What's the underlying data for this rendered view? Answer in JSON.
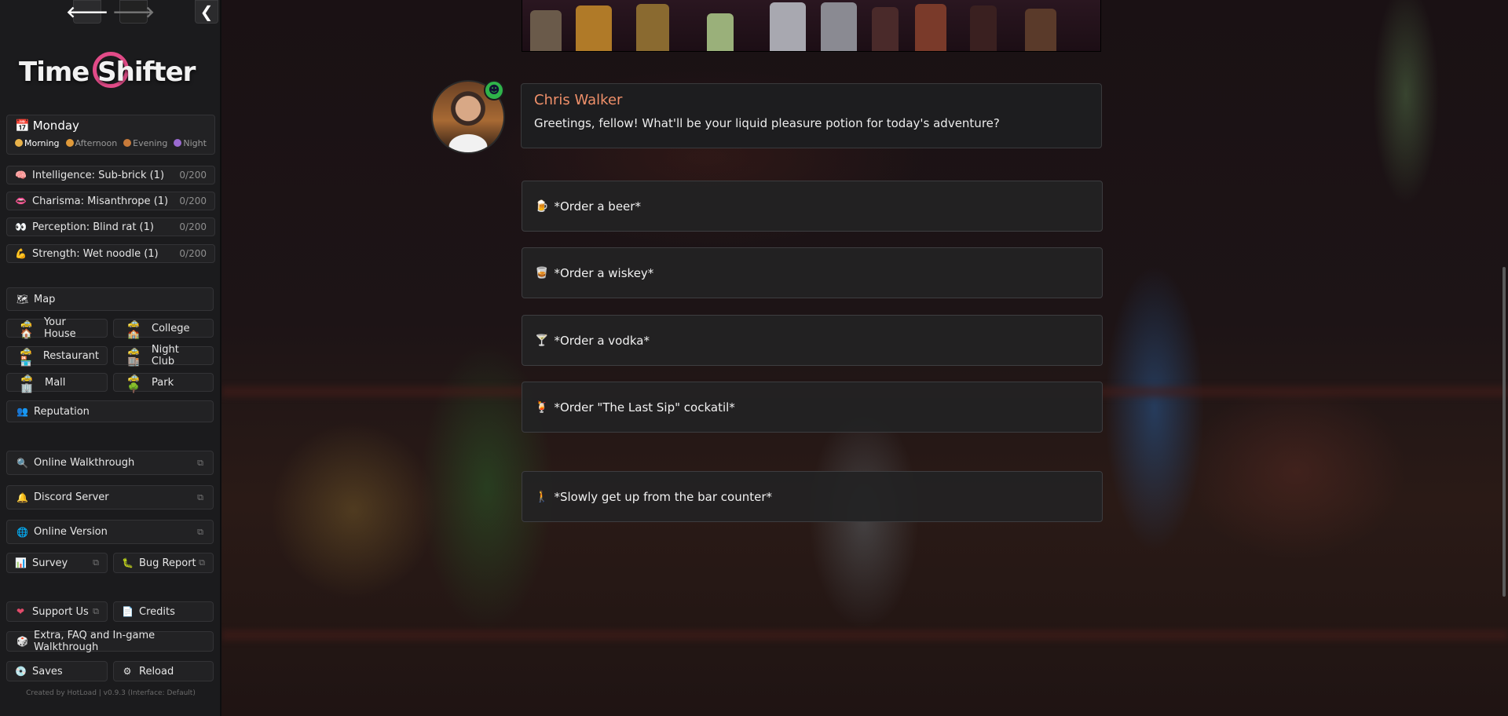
{
  "app": {
    "logo": "Time Shifter"
  },
  "nav": {
    "back": "🡐",
    "forward": "🡒",
    "collapse": "❮"
  },
  "day": {
    "name": "Monday",
    "times": [
      {
        "label": "Morning",
        "color": "#e8b24a",
        "active": true
      },
      {
        "label": "Afternoon",
        "color": "#e09a3a",
        "active": false
      },
      {
        "label": "Evening",
        "color": "#c77a3a",
        "active": false
      },
      {
        "label": "Night",
        "color": "#9a6ad0",
        "active": false
      }
    ]
  },
  "stats": [
    {
      "icon": "🧠",
      "label": "Intelligence: Sub-brick (1)",
      "value": "0/200"
    },
    {
      "icon": "👄",
      "label": "Charisma: Misanthrope (1)",
      "value": "0/200"
    },
    {
      "icon": "👀",
      "label": "Perception: Blind rat (1)",
      "value": "0/200"
    },
    {
      "icon": "💪",
      "label": "Strength: Wet noodle (1)",
      "value": "0/200"
    }
  ],
  "map": {
    "title": "Map",
    "icon": "🗺",
    "locations": [
      {
        "icon": "🚕 🏠",
        "label": "Your House"
      },
      {
        "icon": "🚕 🏫",
        "label": "College"
      },
      {
        "icon": "🚕 🏪",
        "label": "Restaurant"
      },
      {
        "icon": "🚕 🏬",
        "label": "Night Club"
      },
      {
        "icon": "🚕 🏢",
        "label": "Mall"
      },
      {
        "icon": "🚕 🌳",
        "label": "Park"
      }
    ]
  },
  "reputation": {
    "icon": "👥",
    "label": "Reputation"
  },
  "links": [
    {
      "icon": "🔍",
      "label": "Online Walkthrough"
    },
    {
      "icon": "🔔",
      "label": "Discord Server"
    },
    {
      "icon": "🌐",
      "label": "Online Version"
    }
  ],
  "survey": {
    "icon": "📊",
    "label": "Survey"
  },
  "bug_report": {
    "icon": "🐛",
    "label": "Bug Report"
  },
  "support": {
    "icon": "❤",
    "label": "Support Us"
  },
  "credits": {
    "icon": "📄",
    "label": "Credits"
  },
  "extra": {
    "icon": "🎲",
    "label": "Extra, FAQ and In-game Walkthrough"
  },
  "saves": {
    "icon": "💿",
    "label": "Saves"
  },
  "reload": {
    "icon": "⚙",
    "label": "Reload"
  },
  "external_glyph": "⧉",
  "footer": "Created by HotLoad | v0.9.3 (Interface: Default)",
  "dialog": {
    "speaker": "Chris Walker",
    "text": "Greetings, fellow! What'll be your liquid pleasure potion for today's adventure?",
    "mood_icon": "☻"
  },
  "choices": [
    {
      "icon": "🍺",
      "text": "*Order a beer*"
    },
    {
      "icon": "🥃",
      "text": "*Order a wiskey*"
    },
    {
      "icon": "🍸",
      "text": "*Order a vodka*"
    },
    {
      "icon": "🍹",
      "text": "*Order \"The Last Sip\" cockatil*"
    },
    {
      "icon": "🚶",
      "text": "*Slowly get up from the bar counter*"
    }
  ]
}
